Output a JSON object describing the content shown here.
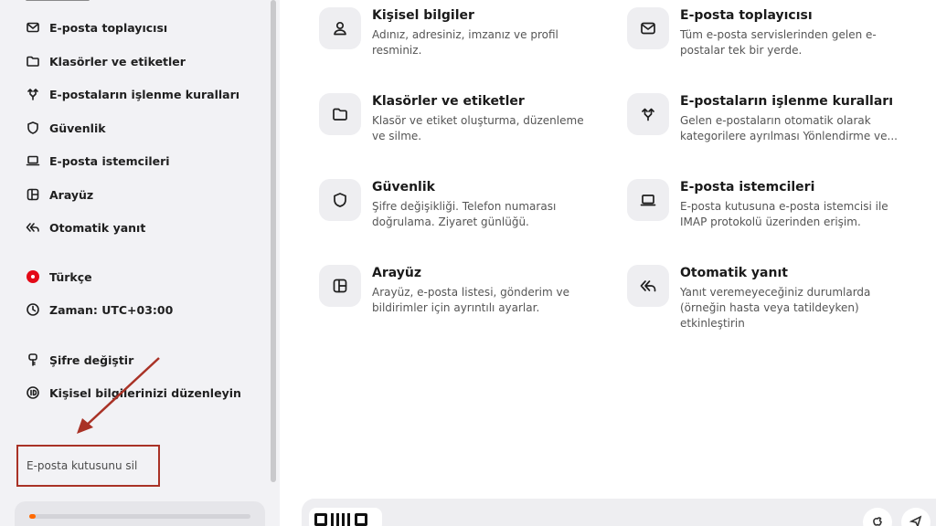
{
  "sidebar": {
    "items": [
      {
        "label": "E-posta toplayıcısı",
        "icon": "envelope-icon"
      },
      {
        "label": "Klasörler ve etiketler",
        "icon": "folder-icon"
      },
      {
        "label": "E-postaların işlenme kuralları",
        "icon": "rules-icon"
      },
      {
        "label": "Güvenlik",
        "icon": "shield-icon"
      },
      {
        "label": "E-posta istemcileri",
        "icon": "laptop-icon"
      },
      {
        "label": "Arayüz",
        "icon": "layout-icon"
      },
      {
        "label": "Otomatik yanıt",
        "icon": "reply-all-icon"
      },
      {
        "label": "Türkçe",
        "icon": "turkey-flag-icon"
      },
      {
        "label": "Zaman: UTC+03:00",
        "icon": "clock-icon"
      },
      {
        "label": "Şifre değiştir",
        "icon": "key-icon"
      },
      {
        "label": "Kişisel bilgilerinizi düzenleyin",
        "icon": "id-icon"
      }
    ],
    "delete_mailbox": "E-posta kutusunu sil",
    "storage_progress": 0.02,
    "accent_color": "#a93226",
    "progress_color": "#ff6a00"
  },
  "cards": [
    {
      "title": "Kişisel bilgiler",
      "desc": "Adınız, adresiniz, imzanız ve profil resminiz.",
      "icon": "person-icon"
    },
    {
      "title": "E-posta toplayıcısı",
      "desc": "Tüm e-posta servislerinden gelen e-postalar tek bir yerde.",
      "icon": "envelope-icon"
    },
    {
      "title": "Klasörler ve etiketler",
      "desc": "Klasör ve etiket oluşturma, düzenleme ve silme.",
      "icon": "folder-icon"
    },
    {
      "title": "E-postaların işlenme kuralları",
      "desc": "Gelen e-postaların otomatik olarak kategorilere ayrılması Yönlendirme ve...",
      "icon": "rules-icon"
    },
    {
      "title": "Güvenlik",
      "desc": "Şifre değişikliği. Telefon numarası doğrulama. Ziyaret günlüğü.",
      "icon": "shield-icon"
    },
    {
      "title": "E-posta istemcileri",
      "desc": "E-posta kutusuna e-posta istemcisi ile IMAP protokolü üzerinden erişim.",
      "icon": "laptop-icon"
    },
    {
      "title": "Arayüz",
      "desc": "Arayüz, e-posta listesi, gönderim ve bildirimler için ayrıntılı ayarlar.",
      "icon": "layout-icon"
    },
    {
      "title": "Otomatik yanıt",
      "desc": "Yanıt veremeyeceğiniz durumlarda (örneğin hasta veya tatildeyken) etkinleştirin",
      "icon": "reply-all-icon"
    }
  ]
}
